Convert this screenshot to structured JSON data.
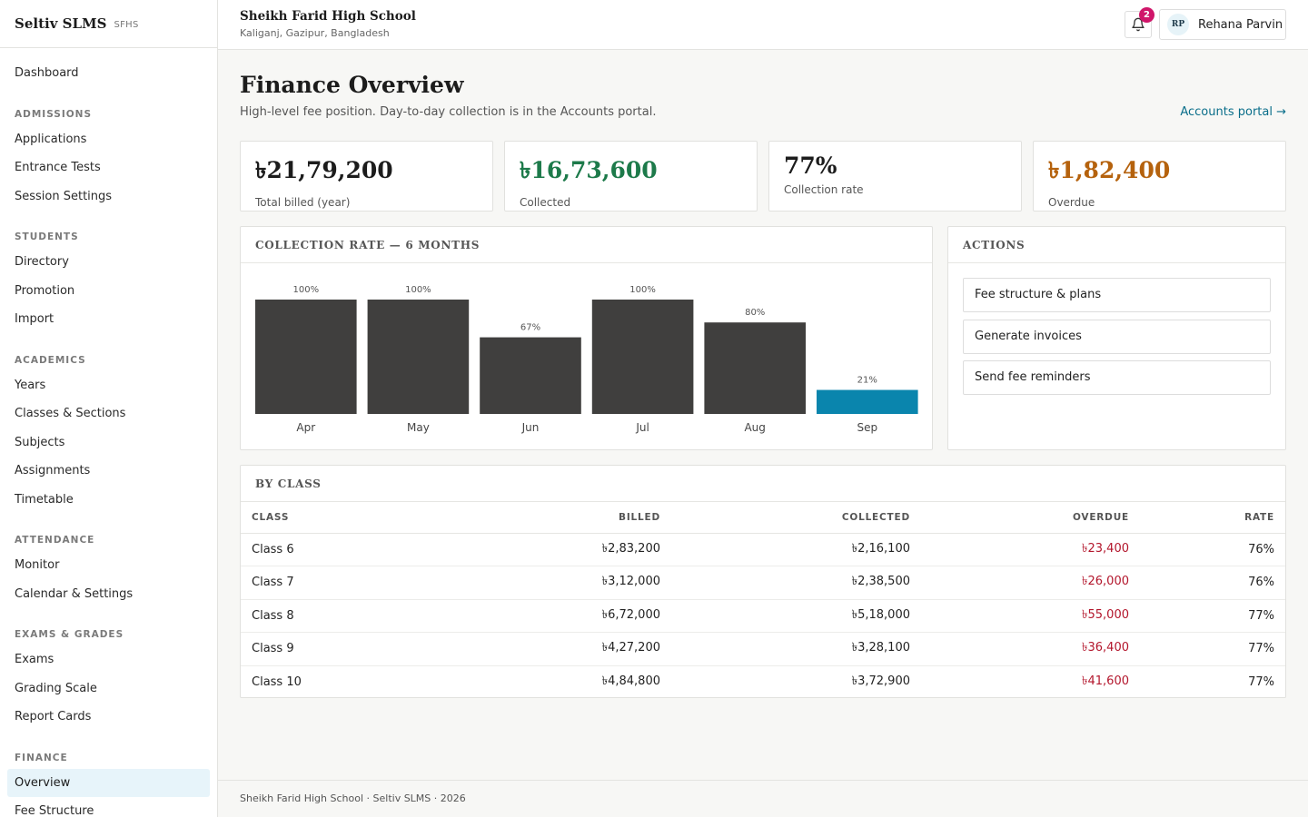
{
  "brand": {
    "name": "Seltiv SLMS",
    "code": "SFHS"
  },
  "sidebar": {
    "items": [
      {
        "type": "item",
        "label": "Dashboard"
      },
      {
        "type": "group",
        "label": "ADMISSIONS"
      },
      {
        "type": "item",
        "label": "Applications"
      },
      {
        "type": "item",
        "label": "Entrance Tests"
      },
      {
        "type": "item",
        "label": "Session Settings"
      },
      {
        "type": "group",
        "label": "STUDENTS"
      },
      {
        "type": "item",
        "label": "Directory"
      },
      {
        "type": "item",
        "label": "Promotion"
      },
      {
        "type": "item",
        "label": "Import"
      },
      {
        "type": "group",
        "label": "ACADEMICS"
      },
      {
        "type": "item",
        "label": "Years"
      },
      {
        "type": "item",
        "label": "Classes & Sections"
      },
      {
        "type": "item",
        "label": "Subjects"
      },
      {
        "type": "item",
        "label": "Assignments"
      },
      {
        "type": "item",
        "label": "Timetable"
      },
      {
        "type": "group",
        "label": "ATTENDANCE"
      },
      {
        "type": "item",
        "label": "Monitor"
      },
      {
        "type": "item",
        "label": "Calendar & Settings"
      },
      {
        "type": "group",
        "label": "EXAMS & GRADES"
      },
      {
        "type": "item",
        "label": "Exams"
      },
      {
        "type": "item",
        "label": "Grading Scale"
      },
      {
        "type": "item",
        "label": "Report Cards"
      },
      {
        "type": "group",
        "label": "FINANCE"
      },
      {
        "type": "item",
        "label": "Overview",
        "active": true
      },
      {
        "type": "item",
        "label": "Fee Structure"
      }
    ]
  },
  "header": {
    "school_name": "Sheikh Farid High School",
    "school_location": "Kaliganj, Gazipur, Bangladesh",
    "notification_count": "2",
    "user_initials": "RP",
    "user_name": "Rehana Parvin"
  },
  "page": {
    "title": "Finance Overview",
    "subtitle": "High-level fee position. Day-to-day collection is in the Accounts portal.",
    "portal_link": "Accounts portal →"
  },
  "stats": [
    {
      "value": "৳21,79,200",
      "label": "Total billed (year)",
      "color": "#1c1c1c"
    },
    {
      "value": "৳16,73,600",
      "label": "Collected",
      "color": "#1d7a4a"
    },
    {
      "value": "77%",
      "label": "Collection rate",
      "color": "#1c1c1c"
    },
    {
      "value": "৳1,82,400",
      "label": "Overdue",
      "color": "#b5620d"
    }
  ],
  "chart_panel": {
    "title": "COLLECTION RATE — 6 MONTHS"
  },
  "chart_data": {
    "type": "bar",
    "categories": [
      "Apr",
      "May",
      "Jun",
      "Jul",
      "Aug",
      "Sep"
    ],
    "values": [
      100,
      100,
      67,
      100,
      80,
      21
    ],
    "value_labels": [
      "100%",
      "100%",
      "67%",
      "100%",
      "80%",
      "21%"
    ],
    "ylim": [
      0,
      100
    ],
    "bar_color": "#403f3e",
    "highlight_color": "#0a85ad",
    "highlight_index": 5,
    "grid": false,
    "title": "",
    "xlabel": "",
    "ylabel": ""
  },
  "actions": {
    "title": "ACTIONS",
    "buttons": [
      "Fee structure & plans",
      "Generate invoices",
      "Send fee reminders"
    ]
  },
  "by_class": {
    "title": "BY CLASS",
    "columns": [
      "CLASS",
      "BILLED",
      "COLLECTED",
      "OVERDUE",
      "RATE"
    ],
    "rows": [
      [
        "Class 6",
        "৳2,83,200",
        "৳2,16,100",
        "৳23,400",
        "76%"
      ],
      [
        "Class 7",
        "৳3,12,000",
        "৳2,38,500",
        "৳26,000",
        "76%"
      ],
      [
        "Class 8",
        "৳6,72,000",
        "৳5,18,000",
        "৳55,000",
        "77%"
      ],
      [
        "Class 9",
        "৳4,27,200",
        "৳3,28,100",
        "৳36,400",
        "77%"
      ],
      [
        "Class 10",
        "৳4,84,800",
        "৳3,72,900",
        "৳41,600",
        "77%"
      ]
    ]
  },
  "footer": {
    "text": "Sheikh Farid High School · Seltiv SLMS · 2026"
  },
  "colors": {
    "accent": "#0a85ad",
    "link": "#0a6e8a",
    "danger": "#b3162c",
    "badge": "#d0166a"
  }
}
